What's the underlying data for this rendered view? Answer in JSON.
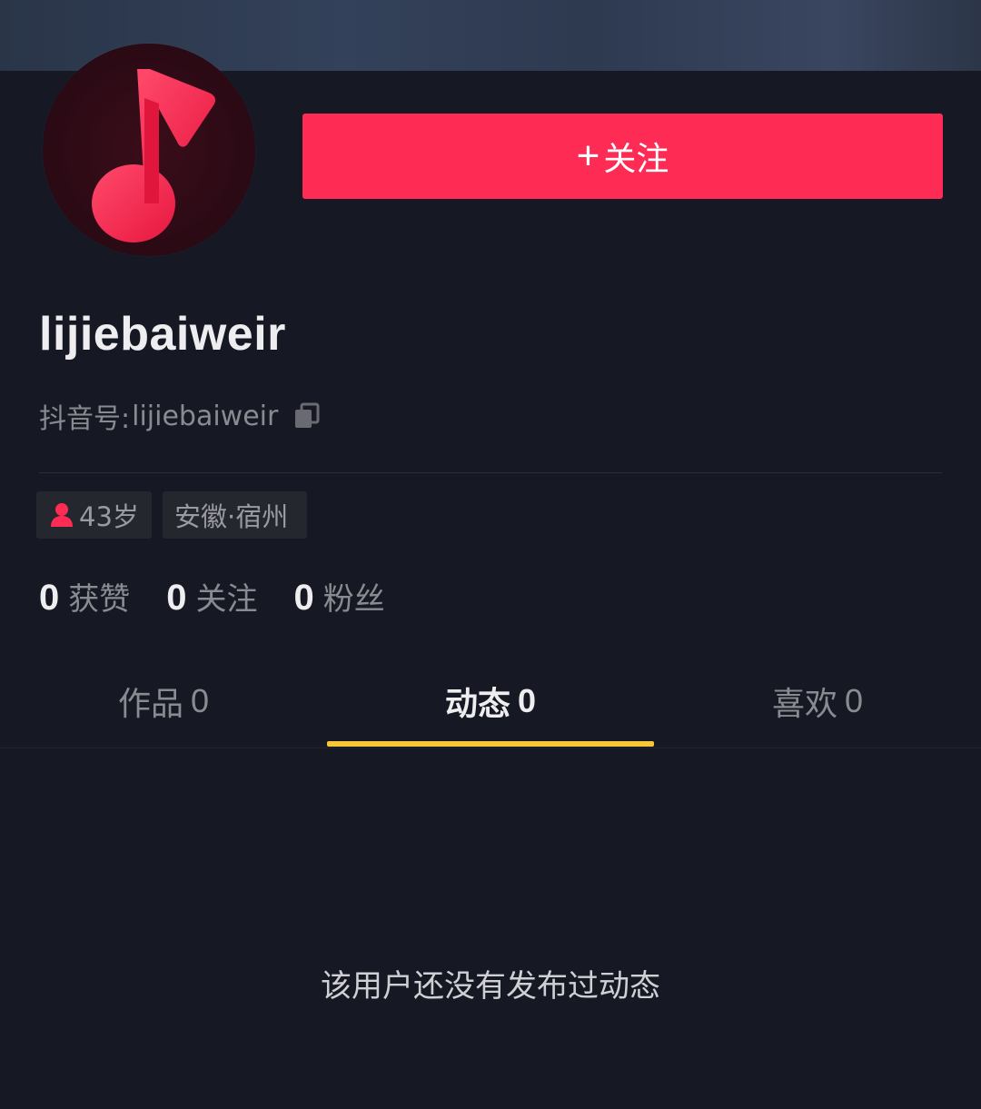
{
  "header": {
    "follow_button_plus": "+",
    "follow_button_label": "关注"
  },
  "profile": {
    "username": "lijiebaiweir",
    "id_prefix": "抖音号:",
    "id_value": "lijiebaiweir",
    "avatar_icon": "music-note-icon",
    "copy_icon": "copy-icon",
    "tags": {
      "age": "43岁",
      "location": "安徽·宿州"
    },
    "stats": [
      {
        "num": "0",
        "label": "获赞"
      },
      {
        "num": "0",
        "label": "关注"
      },
      {
        "num": "0",
        "label": "粉丝"
      }
    ]
  },
  "tabs": [
    {
      "label": "作品",
      "count": "0",
      "active": false
    },
    {
      "label": "动态",
      "count": "0",
      "active": true
    },
    {
      "label": "喜欢",
      "count": "0",
      "active": false
    }
  ],
  "empty_state": {
    "message": "该用户还没有发布过动态"
  },
  "colors": {
    "background": "#161823",
    "accent": "#fe2c55",
    "tab_indicator": "#f7c737"
  }
}
